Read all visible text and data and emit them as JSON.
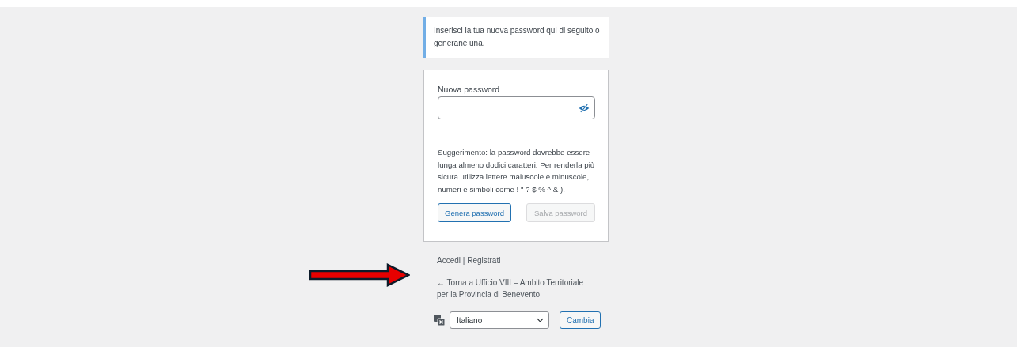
{
  "notice": {
    "text": "Inserisci la tua nuova password qui di seguito o generane una."
  },
  "form": {
    "label": "Nuova password",
    "password_visible": false,
    "hint": "Suggerimento: la password dovrebbe essere lunga almeno dodici caratteri. Per renderla più sicura utilizza lettere maiuscole e minuscole, numeri e simboli come ! \" ? $ % ^ & ).",
    "buttons": [
      {
        "label": "Genera password",
        "disabled": false
      },
      {
        "label": "Salva password",
        "disabled": true
      }
    ]
  },
  "nav": {
    "links": [
      "Accedi",
      "Registrati"
    ],
    "separator": "|",
    "back_link": "← Torna a Ufficio VIII – Ambito Territoriale per la Provincia di Benevento"
  },
  "language": {
    "value": "Italiano",
    "button": "Cambia"
  },
  "annotation": {
    "kind": "arrow"
  }
}
